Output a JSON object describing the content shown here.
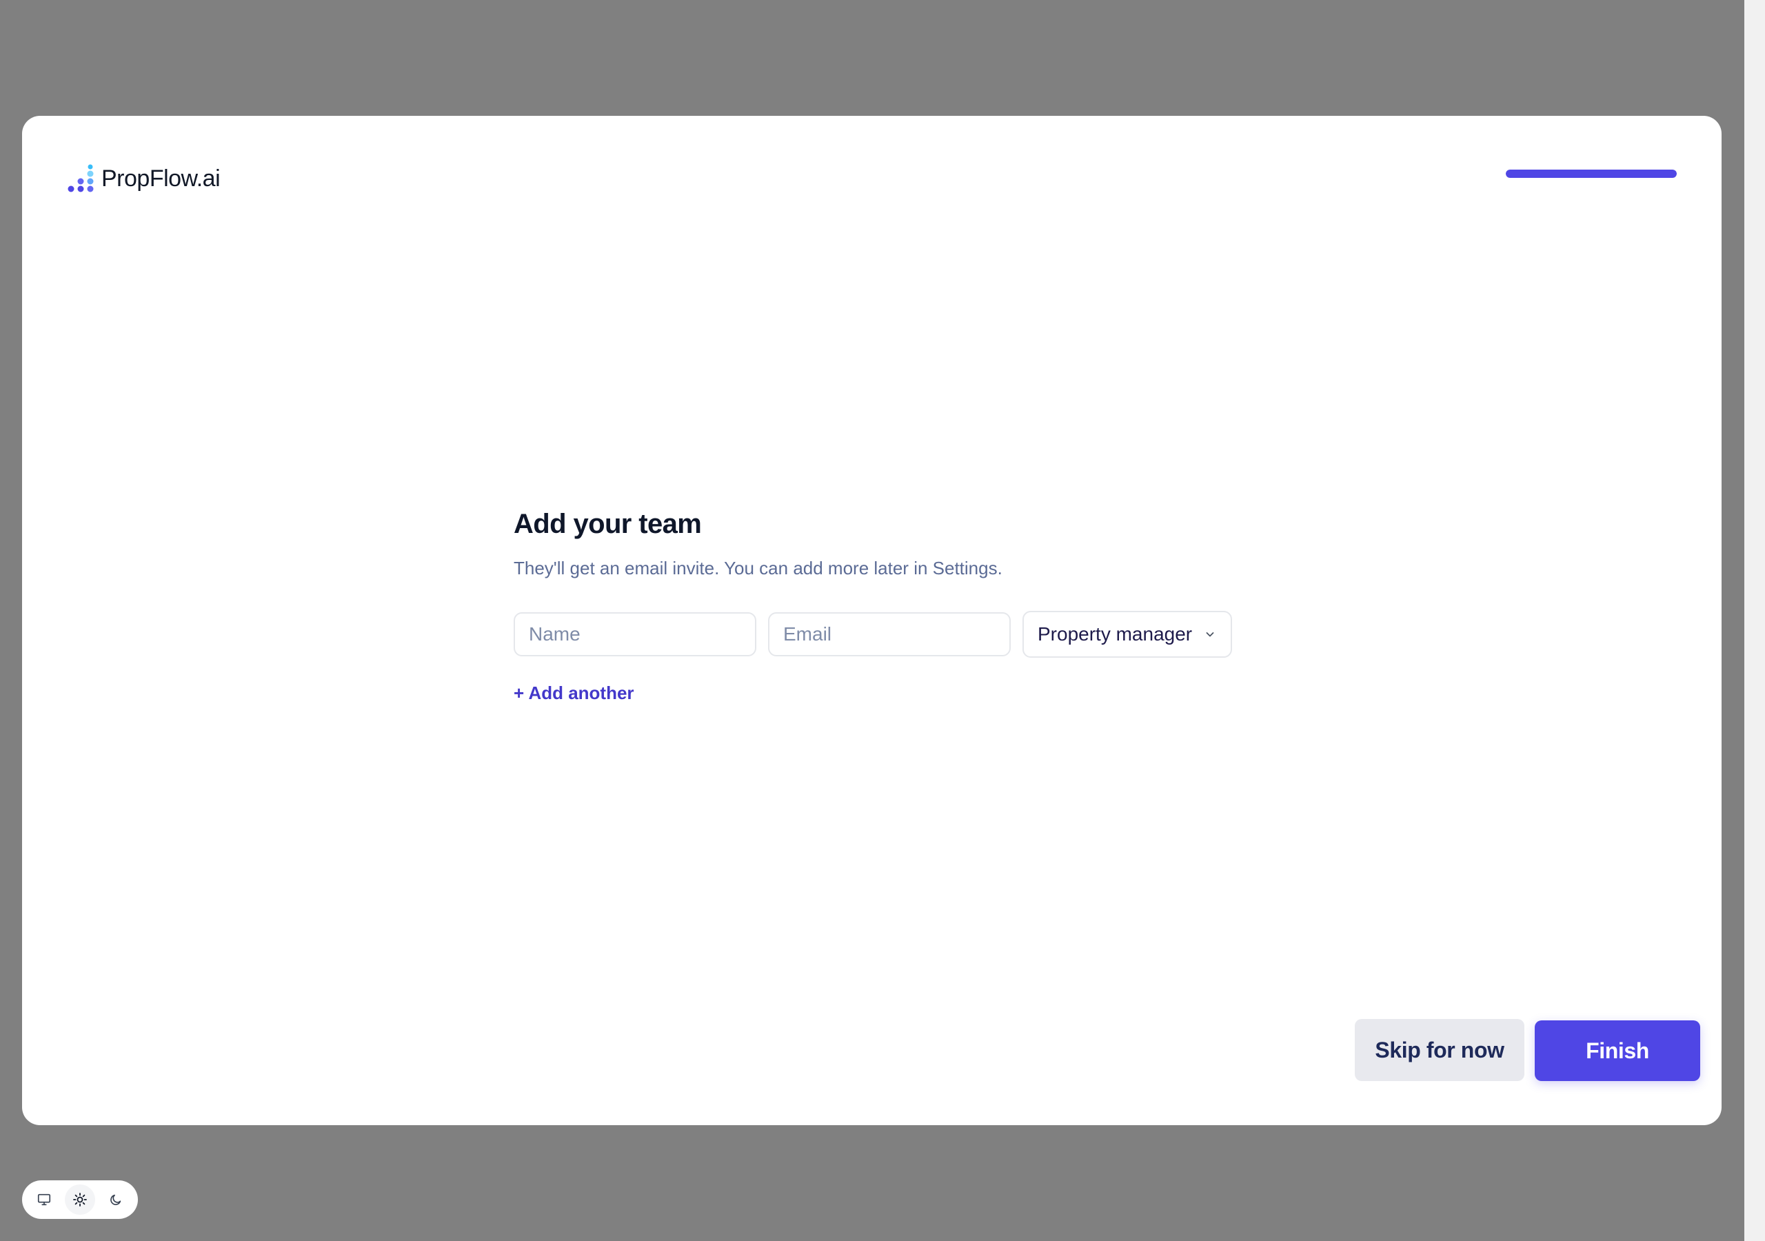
{
  "brand": {
    "name": "PropFlow.ai",
    "logo_icon": "bar-dots-logo-icon",
    "accent": "#4f46e5"
  },
  "onboarding": {
    "progress_fraction": 1.0
  },
  "main": {
    "title": "Add your team",
    "subtitle": "They'll get an email invite. You can add more later in Settings.",
    "name_placeholder": "Name",
    "email_placeholder": "Email",
    "role_selected": "Property manager",
    "add_another": "+ Add another"
  },
  "footer": {
    "skip_label": "Skip for now",
    "finish_label": "Finish"
  },
  "theme_switch": {
    "options": [
      "monitor-icon",
      "sun-icon",
      "moon-icon"
    ],
    "active": "sun-icon"
  }
}
